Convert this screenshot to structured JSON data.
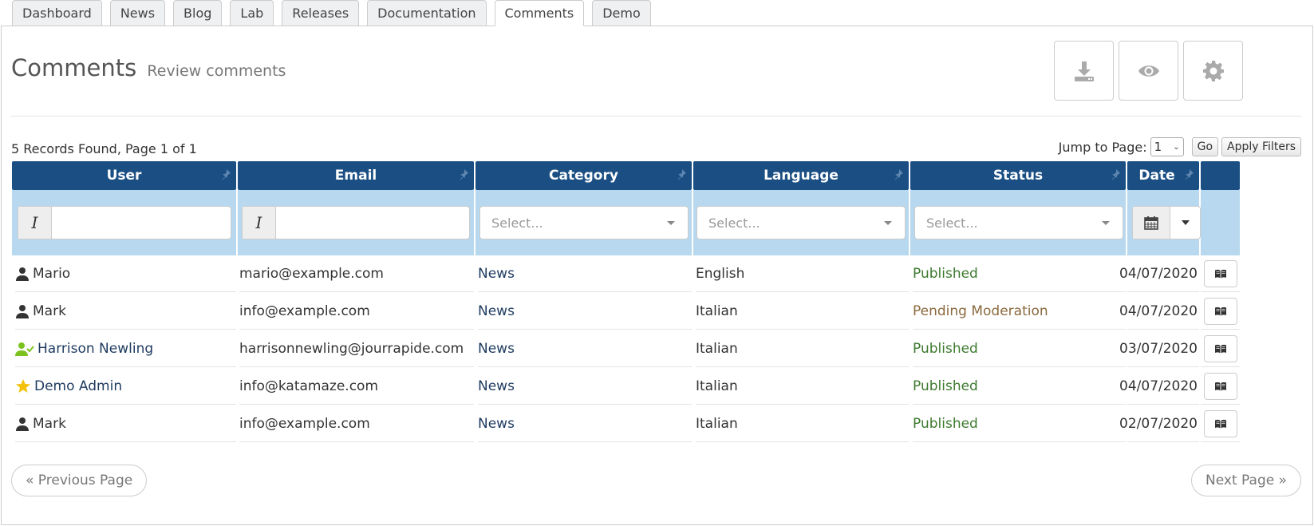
{
  "tabs": [
    {
      "label": "Dashboard"
    },
    {
      "label": "News"
    },
    {
      "label": "Blog"
    },
    {
      "label": "Lab"
    },
    {
      "label": "Releases"
    },
    {
      "label": "Documentation"
    },
    {
      "label": "Comments",
      "active": true
    },
    {
      "label": "Demo"
    }
  ],
  "page": {
    "title": "Comments",
    "subtitle": "Review comments"
  },
  "toolbar": {
    "buttons": [
      {
        "icon": "download-icon"
      },
      {
        "icon": "eye-icon"
      },
      {
        "icon": "gear-icon"
      }
    ]
  },
  "grid": {
    "records_text": "5 Records Found, Page 1 of 1",
    "jump_label": "Jump to Page:",
    "jump_value": "1",
    "go_label": "Go",
    "apply_filters_label": "Apply Filters",
    "columns": [
      "User",
      "Email",
      "Category",
      "Language",
      "Status",
      "Date"
    ],
    "filters": {
      "category_placeholder": "Select...",
      "language_placeholder": "Select...",
      "status_placeholder": "Select..."
    },
    "rows": [
      {
        "user": "Mario",
        "user_icon": "user-icon",
        "email": "mario@example.com",
        "category": "News",
        "language": "English",
        "status": "Published",
        "status_type": "published",
        "date": "04/07/2020"
      },
      {
        "user": "Mark",
        "user_icon": "user-icon",
        "email": "info@example.com",
        "category": "News",
        "language": "Italian",
        "status": "Pending Moderation",
        "status_type": "pending",
        "date": "04/07/2020"
      },
      {
        "user": "Harrison Newling",
        "user_icon": "verified-user-icon",
        "email": "harrisonnewling@jourrapide.com",
        "category": "News",
        "language": "Italian",
        "status": "Published",
        "status_type": "published",
        "date": "03/07/2020"
      },
      {
        "user": "Demo Admin",
        "user_icon": "star-icon",
        "email": "info@katamaze.com",
        "category": "News",
        "language": "Italian",
        "status": "Published",
        "status_type": "published",
        "date": "04/07/2020"
      },
      {
        "user": "Mark",
        "user_icon": "user-icon",
        "email": "info@example.com",
        "category": "News",
        "language": "Italian",
        "status": "Published",
        "status_type": "published",
        "date": "02/07/2020"
      }
    ]
  },
  "pagination": {
    "prev_label": "« Previous Page",
    "next_label": "Next Page »"
  },
  "colors": {
    "header_bg": "#1b4f84",
    "filter_bg": "#b7d8ee",
    "published": "#3d7a2f",
    "pending": "#8a6a3e",
    "verified_user": "#7cc21f",
    "star": "#f4c20d"
  }
}
